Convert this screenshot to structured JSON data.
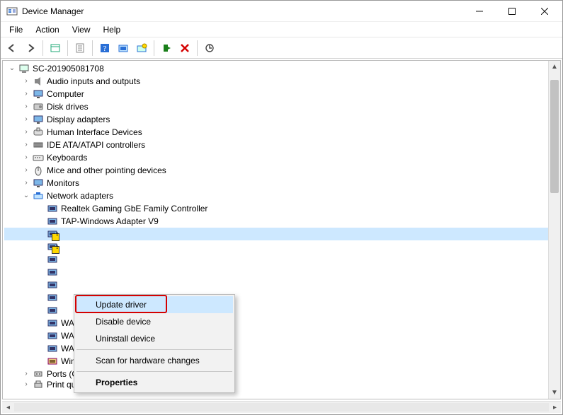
{
  "window": {
    "title": "Device Manager"
  },
  "menubar": [
    "File",
    "Action",
    "View",
    "Help"
  ],
  "toolbar_icons": [
    "back",
    "forward",
    "sep",
    "show-hidden",
    "sep",
    "properties",
    "sep",
    "help",
    "update",
    "scan",
    "sep",
    "enable",
    "uninstall",
    "sep",
    "scan-hw"
  ],
  "root": {
    "label": "SC-201905081708",
    "expanded": true
  },
  "categories": [
    {
      "id": "audio",
      "label": "Audio inputs and outputs",
      "icon": "speaker",
      "expanded": false
    },
    {
      "id": "computer",
      "label": "Computer",
      "icon": "monitor",
      "expanded": false
    },
    {
      "id": "disk",
      "label": "Disk drives",
      "icon": "disk",
      "expanded": false
    },
    {
      "id": "display",
      "label": "Display adapters",
      "icon": "monitor",
      "expanded": false
    },
    {
      "id": "hid",
      "label": "Human Interface Devices",
      "icon": "hid",
      "expanded": false
    },
    {
      "id": "ide",
      "label": "IDE ATA/ATAPI controllers",
      "icon": "ide",
      "expanded": false
    },
    {
      "id": "keyboards",
      "label": "Keyboards",
      "icon": "keyboard",
      "expanded": false
    },
    {
      "id": "mice",
      "label": "Mice and other pointing devices",
      "icon": "mouse",
      "expanded": false
    },
    {
      "id": "monitors",
      "label": "Monitors",
      "icon": "monitor",
      "expanded": false
    },
    {
      "id": "network",
      "label": "Network adapters",
      "icon": "net",
      "expanded": true,
      "children": [
        {
          "label": "Realtek Gaming GbE Family Controller",
          "icon": "nic",
          "warn": false
        },
        {
          "label": "TAP-Windows Adapter V9",
          "icon": "nic",
          "warn": false
        },
        {
          "label": "",
          "icon": "nic",
          "warn": true,
          "selected": true
        },
        {
          "label": "",
          "icon": "nic",
          "warn": true
        },
        {
          "label": "",
          "icon": "nic",
          "warn": false
        },
        {
          "label": "",
          "icon": "nic",
          "warn": false
        },
        {
          "label": "",
          "icon": "nic",
          "warn": false
        },
        {
          "label": "",
          "icon": "nic",
          "warn": false
        },
        {
          "label": "",
          "icon": "nic",
          "warn": false
        },
        {
          "label": "WAN Miniport (PPPOE)",
          "icon": "nic",
          "warn": false,
          "partial": true
        },
        {
          "label": "WAN Miniport (PPTP)",
          "icon": "nic",
          "warn": false
        },
        {
          "label": "WAN Miniport (SSTP)",
          "icon": "nic",
          "warn": false
        },
        {
          "label": "Wintun Userspace Tunnel",
          "icon": "nic2",
          "warn": false
        }
      ]
    },
    {
      "id": "ports",
      "label": "Ports (COM & LPT)",
      "icon": "port",
      "expanded": false
    },
    {
      "id": "printq",
      "label": "Print queues",
      "icon": "printer",
      "expanded": false,
      "cutoff": true
    }
  ],
  "context_menu": {
    "items": [
      {
        "label": "Update driver",
        "highlight": true,
        "redbox": true
      },
      {
        "label": "Disable device",
        "highlight": false
      },
      {
        "label": "Uninstall device",
        "highlight": false
      },
      {
        "sep": true
      },
      {
        "label": "Scan for hardware changes",
        "highlight": false
      },
      {
        "sep": true
      },
      {
        "label": "Properties",
        "highlight": false,
        "bold": true
      }
    ]
  }
}
